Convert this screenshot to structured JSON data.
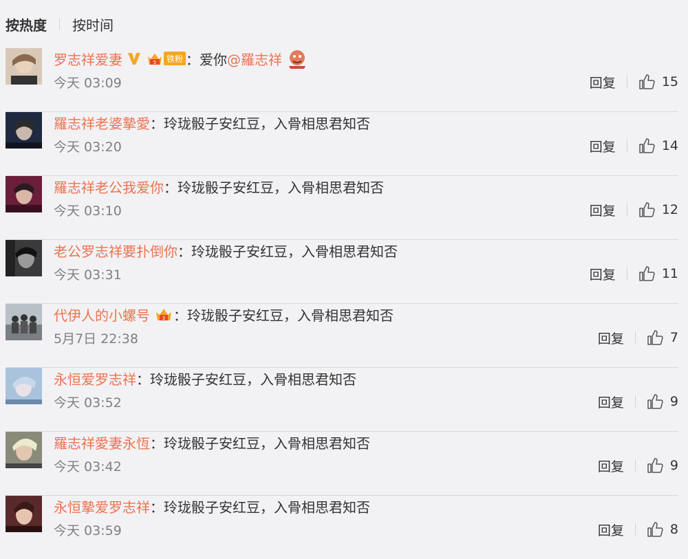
{
  "sort": {
    "hot_label": "按热度",
    "time_label": "按时间",
    "active": "hot"
  },
  "colors": {
    "username": "#eb7350",
    "text": "#333333",
    "meta": "#808080"
  },
  "comments": [
    {
      "user": "罗志祥爱妻",
      "badges": [
        "verified-v-icon",
        "fan-crown-icon",
        "iron-fan-badge"
      ],
      "badge_text": "铁粉",
      "text_prefix": "爱你",
      "mention": "@羅志祥",
      "emoji": "cartoon-emoji-icon",
      "text": "",
      "time": "今天 03:09",
      "reply_label": "回复",
      "likes": "15"
    },
    {
      "user": "羅志祥老婆摯愛",
      "text": "玲珑骰子安红豆，入骨相思君知否",
      "time": "今天 03:20",
      "reply_label": "回复",
      "likes": "14"
    },
    {
      "user": "羅志祥老公我爱你",
      "text": "玲珑骰子安红豆，入骨相思君知否",
      "time": "今天 03:10",
      "reply_label": "回复",
      "likes": "12"
    },
    {
      "user": "老公罗志祥要扑倒你",
      "text": "玲珑骰子安红豆，入骨相思君知否",
      "time": "今天 03:31",
      "reply_label": "回复",
      "likes": "11"
    },
    {
      "user": "代伊人的小螺号",
      "badges": [
        "member-crown-icon"
      ],
      "text": "玲珑骰子安红豆，入骨相思君知否",
      "time": "5月7日 22:38",
      "reply_label": "回复",
      "likes": "7"
    },
    {
      "user": "永恒爱罗志祥",
      "text": "玲珑骰子安红豆，入骨相思君知否",
      "time": "今天 03:52",
      "reply_label": "回复",
      "likes": "9"
    },
    {
      "user": "羅志祥愛妻永恆",
      "text": "玲珑骰子安红豆，入骨相思君知否",
      "time": "今天 03:42",
      "reply_label": "回复",
      "likes": "9"
    },
    {
      "user": "永恒摯爱罗志祥",
      "text": "玲珑骰子安红豆，入骨相思君知否",
      "time": "今天 03:59",
      "reply_label": "回复",
      "likes": "8"
    }
  ],
  "colon": "："
}
